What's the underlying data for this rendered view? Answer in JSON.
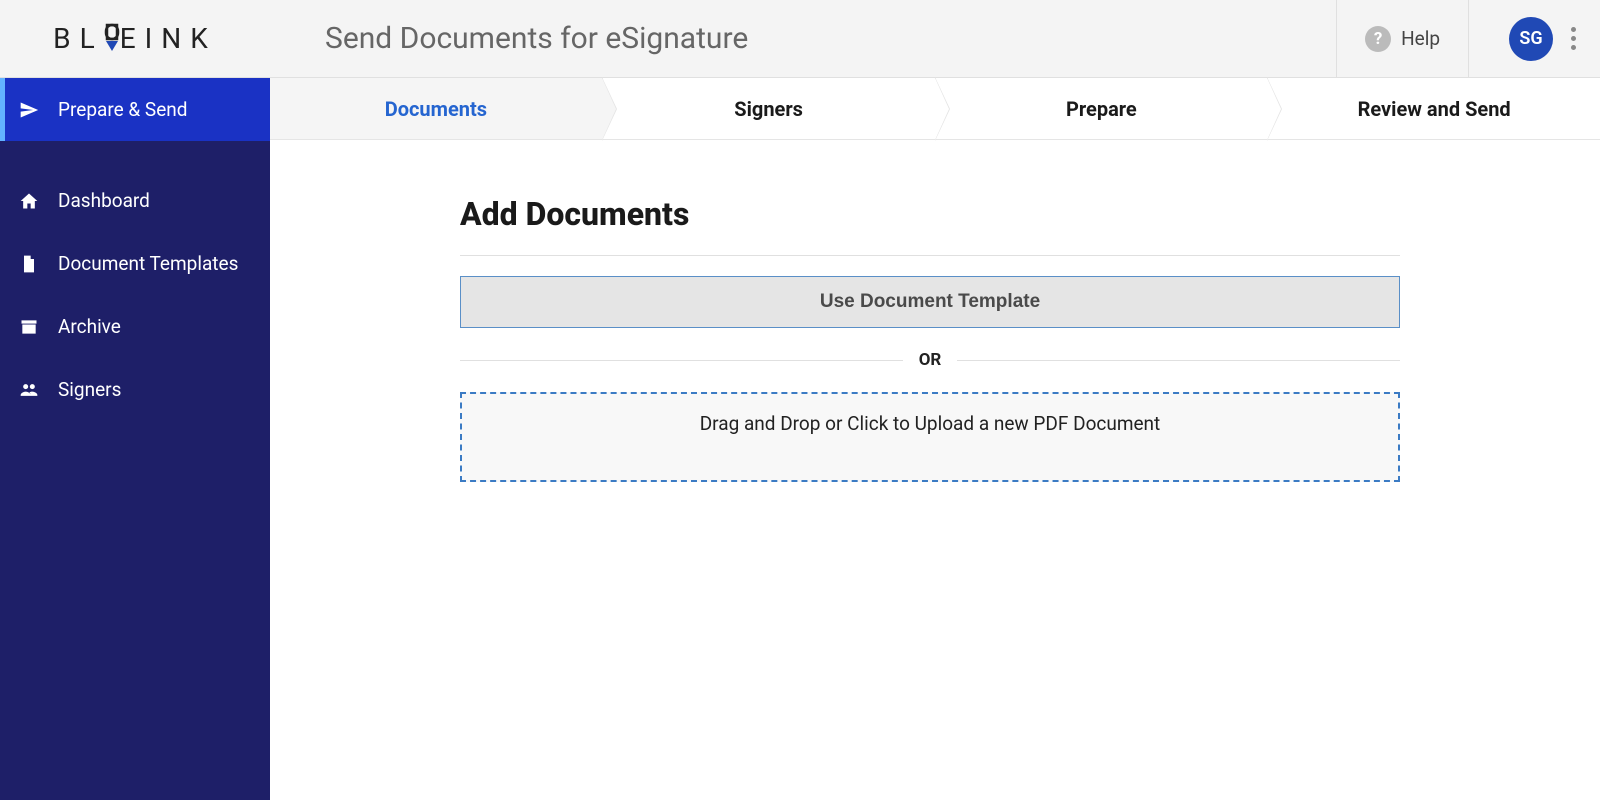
{
  "header": {
    "title": "Send Documents for eSignature",
    "help_label": "Help",
    "avatar_initials": "SG"
  },
  "sidebar": {
    "items": [
      {
        "label": "Prepare & Send",
        "icon": "paper-plane",
        "active": true
      },
      {
        "label": "Dashboard",
        "icon": "home",
        "active": false
      },
      {
        "label": "Document Templates",
        "icon": "file",
        "active": false
      },
      {
        "label": "Archive",
        "icon": "archive-box",
        "active": false
      },
      {
        "label": "Signers",
        "icon": "users",
        "active": false
      }
    ]
  },
  "steps": [
    {
      "label": "Documents",
      "active": true
    },
    {
      "label": "Signers",
      "active": false
    },
    {
      "label": "Prepare",
      "active": false
    },
    {
      "label": "Review and Send",
      "active": false
    }
  ],
  "content": {
    "section_title": "Add Documents",
    "template_button": "Use Document Template",
    "or_label": "OR",
    "dropzone_text": "Drag and Drop or Click to Upload a new PDF Document"
  }
}
